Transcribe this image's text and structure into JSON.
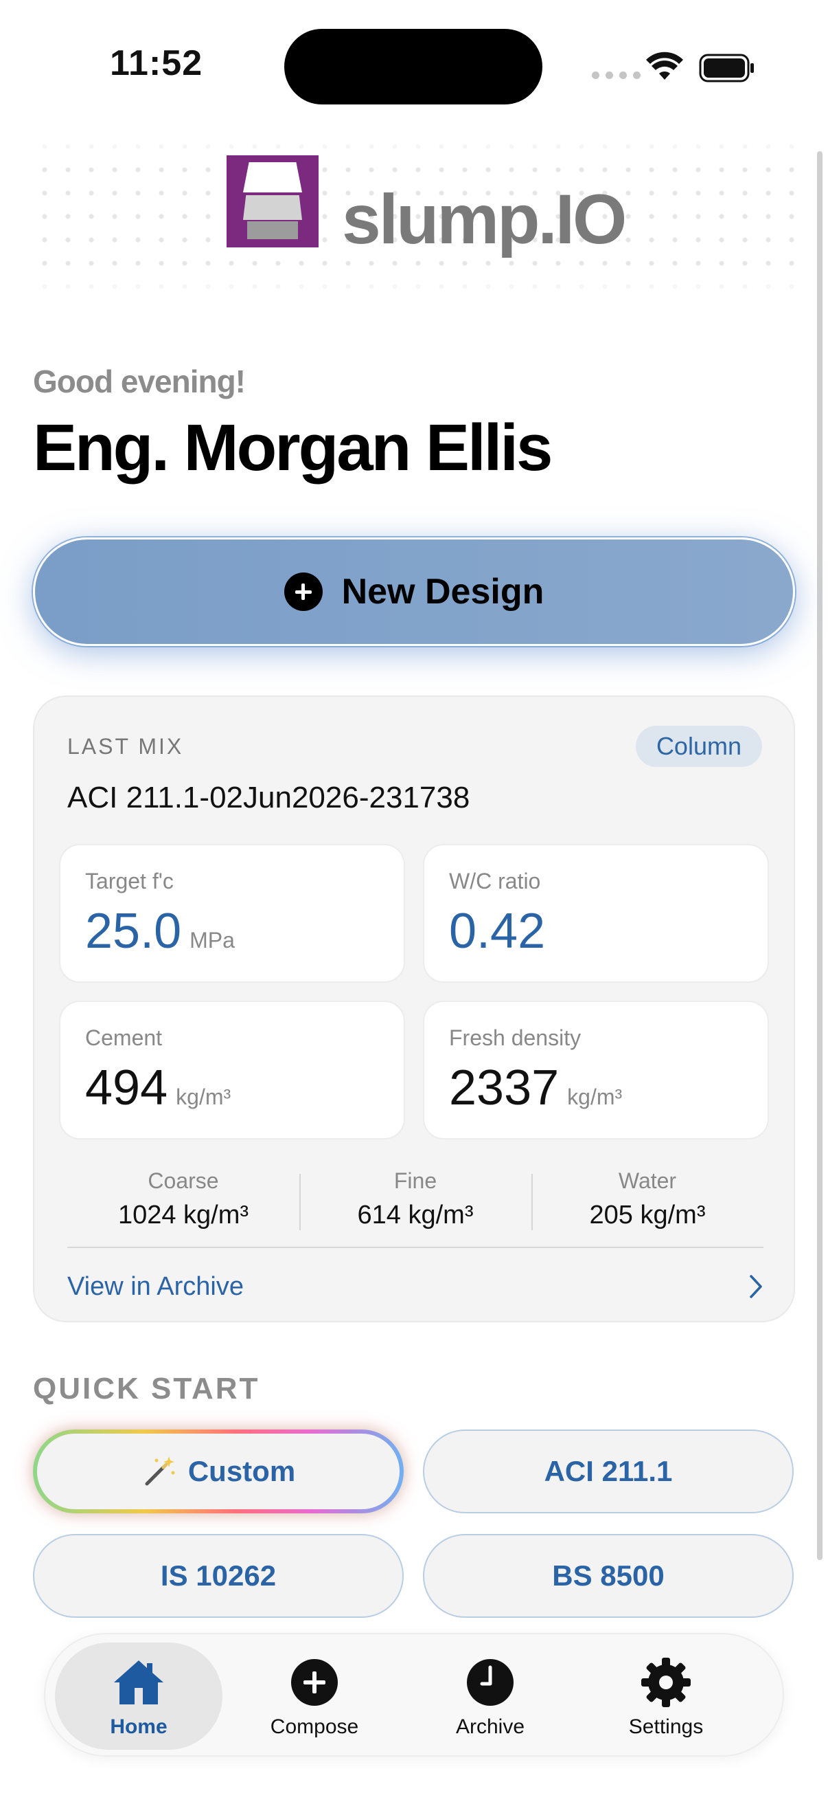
{
  "status_bar": {
    "time": "11:52"
  },
  "app": {
    "name": "slump.IO"
  },
  "greeting": {
    "text": "Good evening!",
    "user_name": "Eng. Morgan Ellis"
  },
  "new_design": {
    "label": "New Design"
  },
  "last_mix": {
    "title": "LAST MIX",
    "badge": "Column",
    "mix_id": "ACI 211.1-02Jun2026-231738",
    "stats": [
      {
        "label": "Target f'c",
        "value": "25.0",
        "unit": "MPa"
      },
      {
        "label": "W/C ratio",
        "value": "0.42",
        "unit": ""
      },
      {
        "label": "Cement",
        "value": "494",
        "unit": "kg/m³"
      },
      {
        "label": "Fresh density",
        "value": "2337",
        "unit": "kg/m³"
      }
    ],
    "aggregates": [
      {
        "label": "Coarse",
        "value": "1024 kg/m³"
      },
      {
        "label": "Fine",
        "value": "614 kg/m³"
      },
      {
        "label": "Water",
        "value": "205 kg/m³"
      }
    ],
    "view_archive": "View in Archive"
  },
  "quick_start": {
    "title": "QUICK START",
    "buttons": [
      "Custom",
      "ACI 211.1",
      "IS 10262",
      "BS 8500"
    ]
  },
  "tab_bar": {
    "items": [
      {
        "label": "Home",
        "icon": "house-icon"
      },
      {
        "label": "Compose",
        "icon": "plus-circle-icon"
      },
      {
        "label": "Archive",
        "icon": "clock-icon"
      },
      {
        "label": "Settings",
        "icon": "gear-icon"
      }
    ]
  },
  "colors": {
    "accent": "#2b64a6",
    "brand": "#7b2a7f",
    "primary_button": "#7a9ec8"
  }
}
